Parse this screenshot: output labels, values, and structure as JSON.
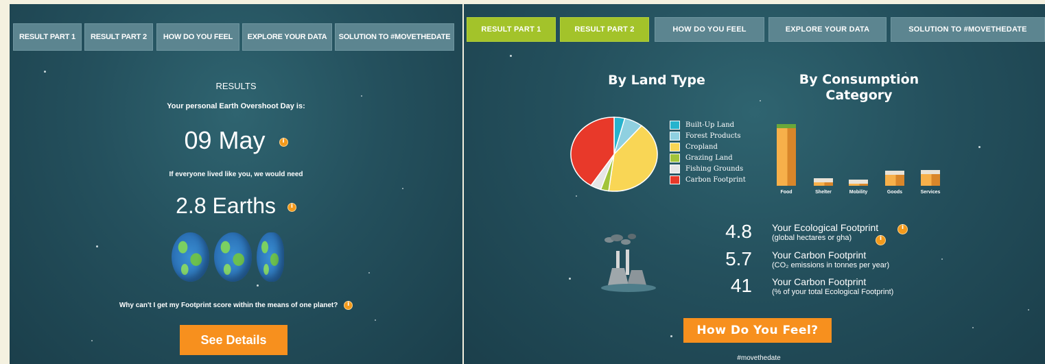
{
  "left": {
    "tabs": [
      {
        "label": "RESULT PART 1",
        "active": true
      },
      {
        "label": "RESULT PART 2",
        "active": false
      },
      {
        "label": "HOW DO YOU FEEL",
        "active": false
      },
      {
        "label": "EXPLORE YOUR DATA",
        "active": false
      },
      {
        "label": "SOLUTION TO #MOVETHEDATE",
        "active": false
      }
    ],
    "results_heading": "RESULTS",
    "overshoot_label": "Your personal Earth Overshoot Day is:",
    "overshoot_date": "09 May",
    "earths_label": "If everyone lived like you, we would need",
    "earths_value": "2.8 Earths",
    "earths_count": 2.8,
    "question": "Why can't I get my Footprint score within the means of one planet?",
    "details_button": "See Details"
  },
  "right": {
    "tabs": [
      {
        "label": "RESULT PART 1",
        "active": true
      },
      {
        "label": "RESULT PART 2",
        "active": true
      },
      {
        "label": "HOW DO YOU FEEL",
        "active": false
      },
      {
        "label": "EXPLORE YOUR DATA",
        "active": false
      },
      {
        "label": "SOLUTION TO #MOVETHEDATE",
        "active": false
      }
    ],
    "land_heading": "By Land Type",
    "consumption_heading_line1": "By Consumption",
    "consumption_heading_line2": "Category",
    "stats": [
      {
        "value": "4.8",
        "title": "Your Ecological Footprint",
        "subtitle": "(global hectares or gha)"
      },
      {
        "value": "5.7",
        "title": "Your Carbon Footprint",
        "subtitle": "(CO₂ emissions in tonnes per year)"
      },
      {
        "value": "41",
        "title": "Your Carbon Footprint",
        "subtitle": "(% of your total Ecological Footprint)"
      }
    ],
    "feel_button": "How Do You Feel?",
    "hashtag": "#movethedate"
  },
  "chart_data": [
    {
      "type": "pie",
      "title": "By Land Type",
      "categories": [
        "Built-Up Land",
        "Forest Products",
        "Cropland",
        "Grazing Land",
        "Fishing Grounds",
        "Carbon Footprint"
      ],
      "values": [
        4,
        7,
        41,
        3,
        4,
        41
      ],
      "colors": [
        "#27b3cd",
        "#8fd0e0",
        "#f9d655",
        "#a2c43a",
        "#e6e6e6",
        "#e8392a"
      ]
    },
    {
      "type": "bar",
      "title": "By Consumption Category",
      "categories": [
        "Food",
        "Shelter",
        "Mobility",
        "Goods",
        "Services"
      ],
      "values": [
        100,
        12,
        10,
        24,
        26
      ],
      "color": "#f5a83a"
    }
  ]
}
